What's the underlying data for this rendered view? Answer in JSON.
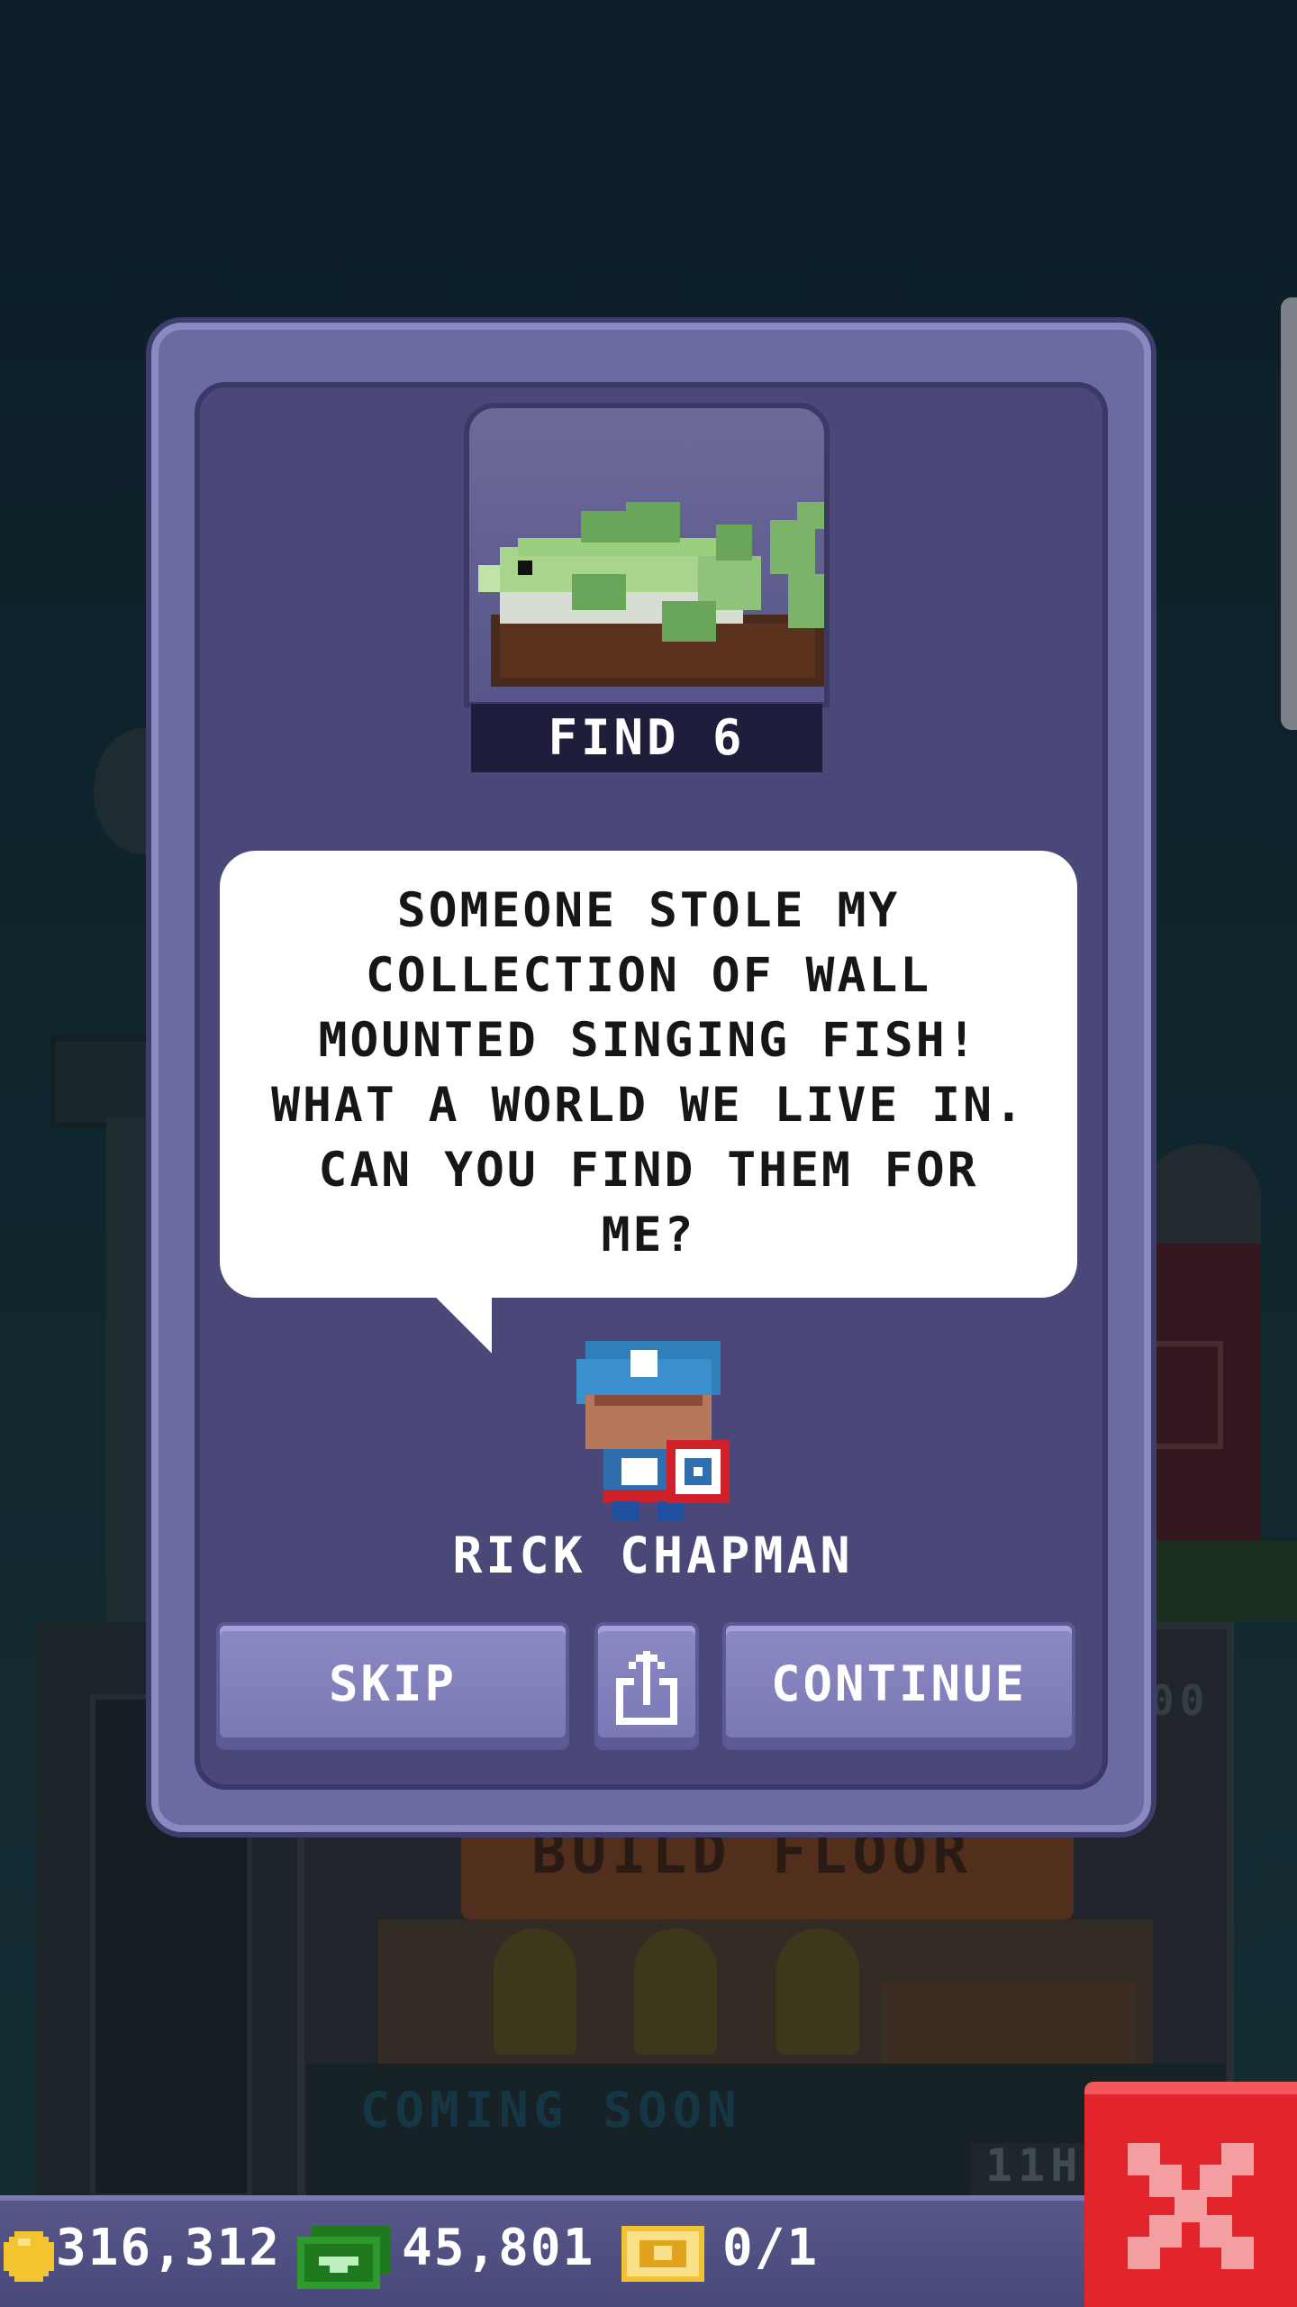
{
  "quest": {
    "label": "FIND 6",
    "item": "fish-icon"
  },
  "dialog": {
    "text": "SOMEONE STOLE MY\nCOLLECTION OF WALL\nMOUNTED SINGING FISH!\nWHAT A WORLD WE LIVE IN.\nCAN YOU FIND THEM FOR\nME?",
    "character_name": "RICK CHAPMAN",
    "character_icon": "captain-character-icon"
  },
  "buttons": {
    "skip": "SKIP",
    "share_icon": "share-icon",
    "continue": "CONTINUE"
  },
  "background": {
    "sign": "BUILD FLOOR",
    "coming_soon": "COMING SOON",
    "timer": "11H",
    "counter": "00"
  },
  "currency": {
    "coins": "316,312",
    "bux": "45,801",
    "tickets": "0/1"
  },
  "colors": {
    "modal_outer": "#6b6aa3",
    "modal_inner": "#4a4878",
    "button": "#7a78b4",
    "close": "#e2242b",
    "coin": "#f4c430",
    "bux": "#2e9a2e",
    "ticket": "#f2c233"
  }
}
